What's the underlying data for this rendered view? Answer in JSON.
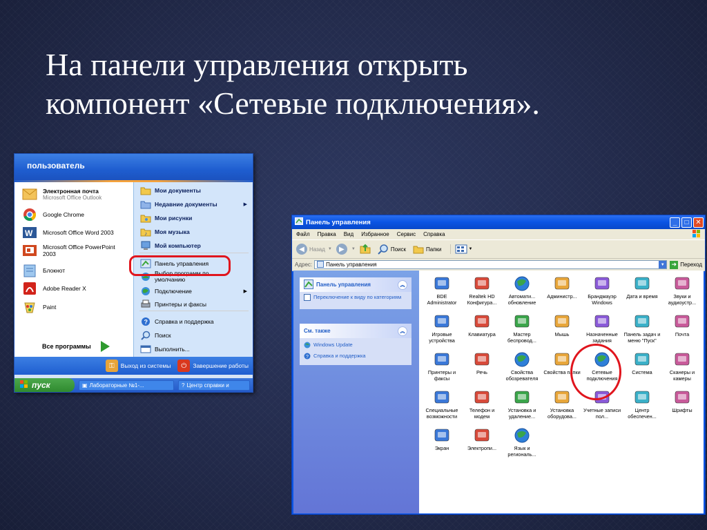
{
  "slide": {
    "title_line1": "На панели управления открыть",
    "title_line2": "компонент «Сетевые подключения»."
  },
  "start_menu": {
    "user": "пользователь",
    "left_items": [
      {
        "title": "Электронная почта",
        "subtitle": "Microsoft Office Outlook"
      },
      {
        "title": "Google Chrome"
      },
      {
        "title": "Microsoft Office Word 2003"
      },
      {
        "title": "Microsoft Office PowerPoint 2003"
      },
      {
        "title": "Блокнот"
      },
      {
        "title": "Adobe Reader X"
      },
      {
        "title": "Paint"
      }
    ],
    "all_programs": "Все программы",
    "right_items": [
      {
        "label": "Мои документы"
      },
      {
        "label": "Недавние документы"
      },
      {
        "label": "Мои рисунки"
      },
      {
        "label": "Моя музыка"
      },
      {
        "label": "Мой компьютер"
      },
      {
        "label": "Панель управления"
      },
      {
        "label": "Выбор программ по умолчанию"
      },
      {
        "label": "Подключение"
      },
      {
        "label": "Принтеры и факсы"
      },
      {
        "label": "Справка и поддержка"
      },
      {
        "label": "Поиск"
      },
      {
        "label": "Выполнить..."
      }
    ],
    "logoff": "Выход из системы",
    "shutdown": "Завершение работы"
  },
  "taskbar": {
    "start": "пуск",
    "tasks": [
      "Лабораторные №1-...",
      "Центр справки и"
    ]
  },
  "control_panel": {
    "title": "Панель управления",
    "menu": [
      "Файл",
      "Правка",
      "Вид",
      "Избранное",
      "Сервис",
      "Справка"
    ],
    "toolbar": {
      "back": "Назад",
      "search": "Поиск",
      "folders": "Папки"
    },
    "address_label": "Адрес:",
    "address_value": "Панель управления",
    "go": "Переход",
    "pane": {
      "title": "Панель управления",
      "switch_link": "Переключение к виду по категориям",
      "see_also": "См. также",
      "see_also_links": [
        "Windows Update",
        "Справка и поддержка"
      ]
    },
    "icons": [
      [
        "BDE Administrator",
        "Realtek HD Конфигура...",
        "Автомати... обновление",
        "Администр...",
        "Брандмауэр Windows",
        "Дата и время",
        "Звуки и аудиоустр..."
      ],
      [
        "Игровые устройства",
        "Клавиатура",
        "Мастер беспровод...",
        "Мышь",
        "Назначенные задания",
        "Панель задач и меню \"Пуск\"",
        "Почта"
      ],
      [
        "Принтеры и факсы",
        "Речь",
        "Свойства обозревателя",
        "Свойства папки",
        "Сетевые подключения",
        "Система",
        "Сканеры и камеры"
      ],
      [
        "Специальные возможности",
        "Телефон и модем",
        "Установка и удаление...",
        "Установка оборудова...",
        "Учетные записи пол...",
        "Центр обеспечен...",
        "Шрифты"
      ],
      [
        "Экран",
        "Электропи...",
        "Язык и региональ..."
      ]
    ],
    "icon_names": [
      [
        "bde-icon",
        "speaker-icon",
        "globe-update-icon",
        "admin-tools-icon",
        "firewall-icon",
        "clock-icon",
        "sound-icon"
      ],
      [
        "gamepad-icon",
        "keyboard-icon",
        "wireless-icon",
        "mouse-icon",
        "scheduled-tasks-icon",
        "taskbar-icon",
        "mail-icon"
      ],
      [
        "printer-icon",
        "speech-icon",
        "globe-icon",
        "folder-icon",
        "network-connections-icon",
        "system-icon",
        "scanner-icon"
      ],
      [
        "accessibility-icon",
        "phone-icon",
        "add-remove-icon",
        "hardware-icon",
        "users-icon",
        "security-shield-icon",
        "fonts-icon"
      ],
      [
        "display-icon",
        "power-icon",
        "region-globe-icon"
      ]
    ]
  }
}
